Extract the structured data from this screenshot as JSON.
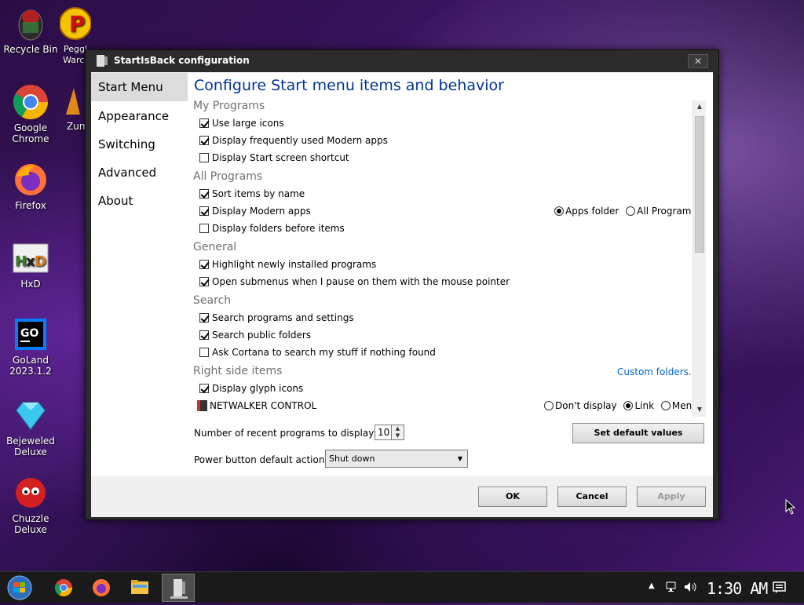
{
  "desktop": {
    "icons": [
      {
        "label": "Recycle Bin"
      },
      {
        "label": "Peggl Warcr"
      },
      {
        "label": "Google Chrome"
      },
      {
        "label": "Zuma"
      },
      {
        "label": "Firefox"
      },
      {
        "label": "HxD"
      },
      {
        "label": "GoLand 2023.1.2"
      },
      {
        "label": "Bejeweled Deluxe"
      },
      {
        "label": "Chuzzle Deluxe"
      }
    ]
  },
  "dialog": {
    "title": "StartIsBack configuration",
    "close_label": "✕",
    "nav": [
      {
        "label": "Start Menu"
      },
      {
        "label": "Appearance"
      },
      {
        "label": "Switching"
      },
      {
        "label": "Advanced"
      },
      {
        "label": "About"
      }
    ],
    "pane_title": "Configure Start menu items and behavior",
    "sections": {
      "my_programs": "My Programs",
      "all_programs": "All Programs",
      "general": "General",
      "search": "Search",
      "right_side": "Right side items"
    },
    "options": {
      "use_large_icons": {
        "label": "Use large icons",
        "checked": true
      },
      "display_frequent_modern": {
        "label": "Display frequently used Modern apps",
        "checked": true
      },
      "display_start_screen_shortcut": {
        "label": "Display Start screen shortcut",
        "checked": false
      },
      "sort_by_name": {
        "label": "Sort items by name",
        "checked": true
      },
      "display_modern_apps": {
        "label": "Display Modern apps",
        "checked": true
      },
      "folders_before_items": {
        "label": "Display folders before items",
        "checked": false
      },
      "highlight_new": {
        "label": "Highlight newly installed programs",
        "checked": true
      },
      "open_submenus": {
        "label": "Open submenus when I pause on them with the mouse pointer",
        "checked": true
      },
      "search_programs": {
        "label": "Search programs and settings",
        "checked": true
      },
      "search_public": {
        "label": "Search public folders",
        "checked": true
      },
      "ask_cortana": {
        "label": "Ask Cortana to search my stuff if nothing found",
        "checked": false
      },
      "display_glyph": {
        "label": "Display glyph icons",
        "checked": true
      }
    },
    "modern_apps_radio": {
      "apps_folder": "Apps folder",
      "all_programs": "All Programs",
      "selected": "apps_folder"
    },
    "custom_folders_link": "Custom folders...",
    "netwalker": {
      "label": "NETWALKER CONTROL",
      "dont_display": "Don't display",
      "link": "Link",
      "menu": "Menu",
      "selected": "link"
    },
    "recent_label": "Number of recent programs to display:",
    "recent_value": "10",
    "power_label": "Power button default action:",
    "power_value": "Shut down",
    "set_defaults_label": "Set default values",
    "ok_label": "OK",
    "cancel_label": "Cancel",
    "apply_label": "Apply"
  },
  "taskbar": {
    "clock": "1:30 AM"
  }
}
